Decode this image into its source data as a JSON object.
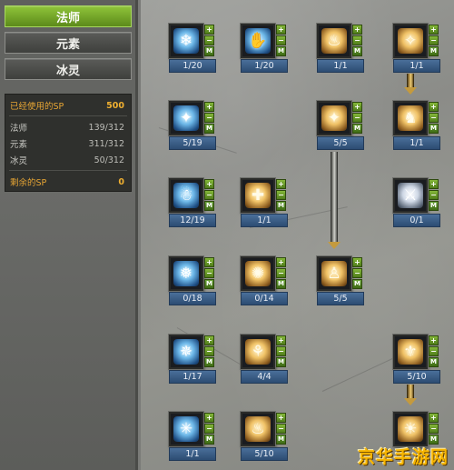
{
  "sidebar": {
    "tabs": [
      {
        "label": "法师",
        "active": true
      },
      {
        "label": "元素",
        "active": false
      },
      {
        "label": "冰灵",
        "active": false
      }
    ],
    "sp": {
      "used_label": "已经使用的SP",
      "used_value": "500",
      "rows": [
        {
          "label": "法师",
          "value": "139/312"
        },
        {
          "label": "元素",
          "value": "311/312"
        },
        {
          "label": "冰灵",
          "value": "50/312"
        }
      ],
      "remaining_label": "剩余的SP",
      "remaining_value": "0"
    }
  },
  "tree": {
    "button_labels": {
      "plus": "+",
      "minus": "−",
      "max": "M"
    },
    "skills": [
      {
        "level": "1/20",
        "icon": "ice-swirl-icon",
        "glyph": "❄",
        "element": "ice"
      },
      {
        "level": "1/20",
        "icon": "ice-claw-icon",
        "glyph": "✋",
        "element": "ice"
      },
      {
        "level": "1/1",
        "icon": "fire-boot-icon",
        "glyph": "♨",
        "element": "fire"
      },
      {
        "level": "1/1",
        "icon": "fire-wings-icon",
        "glyph": "✧",
        "element": "fire"
      },
      {
        "level": "5/19",
        "icon": "ice-star-icon",
        "glyph": "✦",
        "element": "ice"
      },
      {
        "level": "5/5",
        "icon": "fire-figure-icon",
        "glyph": "✦",
        "element": "fire"
      },
      {
        "level": "1/1",
        "icon": "fire-figure-icon",
        "glyph": "♞",
        "element": "fire"
      },
      {
        "level": "12/19",
        "icon": "ice-ghost-icon",
        "glyph": "☃",
        "element": "ice"
      },
      {
        "level": "1/1",
        "icon": "fire-totem-icon",
        "glyph": "✚",
        "element": "fire"
      },
      {
        "level": "0/1",
        "icon": "light-blade-icon",
        "glyph": "⚔",
        "element": "bolt"
      },
      {
        "level": "0/18",
        "icon": "ice-crystal-icon",
        "glyph": "❅",
        "element": "ice"
      },
      {
        "level": "0/14",
        "icon": "fire-orb-icon",
        "glyph": "✺",
        "element": "fire"
      },
      {
        "level": "5/5",
        "icon": "fire-man-icon",
        "glyph": "♙",
        "element": "fire"
      },
      {
        "level": "1/17",
        "icon": "ice-shards-icon",
        "glyph": "✵",
        "element": "ice"
      },
      {
        "level": "4/4",
        "icon": "fire-dancer-icon",
        "glyph": "⚘",
        "element": "fire"
      },
      {
        "level": "5/10",
        "icon": "fire-armor-icon",
        "glyph": "⚜",
        "element": "fire"
      },
      {
        "level": "1/1",
        "icon": "ice-burst-icon",
        "glyph": "✳",
        "element": "ice"
      },
      {
        "level": "5/10",
        "icon": "fire-flame-icon",
        "glyph": "♨",
        "element": "fire"
      },
      {
        "level": "",
        "icon": "fire-sun-icon",
        "glyph": "☀",
        "element": "fire"
      }
    ]
  },
  "watermark": "京华手游网",
  "colors": {
    "accent_green": "#7fb436",
    "sp_orange": "#f0b030",
    "level_blue": "#3a5e88"
  }
}
